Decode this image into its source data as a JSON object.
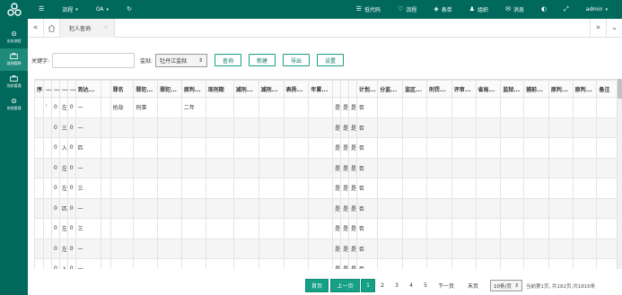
{
  "topbar": {
    "menu_icon": "hamburger-icon",
    "left_items": [
      {
        "label": "流程",
        "caret": "▾"
      },
      {
        "label": "OA",
        "caret": "▾"
      }
    ],
    "refresh_icon": "refresh-icon",
    "right_items": [
      {
        "icon": "☰",
        "label": "低代码"
      },
      {
        "icon": "♡",
        "label": "流程"
      },
      {
        "icon": "◈",
        "label": "表单"
      },
      {
        "icon": "♟",
        "label": "组织"
      },
      {
        "icon": "✉",
        "label": "消息"
      }
    ],
    "user": {
      "label": "admin",
      "caret": "▾"
    }
  },
  "sidebar": {
    "items": [
      {
        "label": "业务流程",
        "icon": "gear-icon"
      },
      {
        "label": "减刑假释",
        "icon": "briefcase-icon",
        "active": true
      },
      {
        "label": "刑务管理",
        "icon": "briefcase-icon"
      },
      {
        "label": "系统管理",
        "icon": "gear-icon"
      }
    ]
  },
  "tabs": {
    "items": [
      {
        "label": "犯人查询",
        "close": "×"
      }
    ]
  },
  "search": {
    "keyword_label": "关键字:",
    "keyword_value": "",
    "prison_label": "监狱:",
    "prison_value": "牡丹江监狱",
    "buttons": [
      "查询",
      "新建",
      "导出",
      "设置"
    ]
  },
  "table": {
    "columns": [
      "序...",
      "...",
      "...",
      "...",
      "...",
      "到达...",
      "",
      "罪名",
      "罪犯...",
      "罪犯...",
      "原判...",
      "现刑期",
      "减刑...",
      "减刑...",
      "表扬...",
      "年累...",
      "",
      "",
      "",
      "计划...",
      "分监...",
      "监区...",
      "刑罚...",
      "评审...",
      "省局...",
      "监狱...",
      "捕前...",
      "原判...",
      "原判...",
      "备注"
    ],
    "rows": [
      [
        "",
        "'",
        "0",
        "左",
        "0",
        "一",
        "",
        "抢劫",
        "刑事",
        "",
        "二年",
        "",
        "",
        "",
        "",
        "",
        "是",
        "是",
        "是",
        "否",
        "",
        "",
        "",
        "",
        "",
        "",
        "",
        "",
        "",
        ""
      ],
      [
        "",
        "",
        "0",
        "三",
        "0",
        "一",
        "",
        "",
        "",
        "",
        "",
        "",
        "",
        "",
        "",
        "",
        "是",
        "是",
        "是",
        "否",
        "",
        "",
        "",
        "",
        "",
        "",
        "",
        "",
        "",
        ""
      ],
      [
        "",
        "",
        "0",
        "入",
        "0",
        "匹",
        "",
        "",
        "",
        "",
        "",
        "",
        "",
        "",
        "",
        "",
        "是",
        "是",
        "是",
        "否",
        "",
        "",
        "",
        "",
        "",
        "",
        "",
        "",
        "",
        ""
      ],
      [
        "",
        "",
        "0",
        "左",
        "0",
        "一",
        "",
        "",
        "",
        "",
        "",
        "",
        "",
        "",
        "",
        "",
        "是",
        "是",
        "是",
        "否",
        "",
        "",
        "",
        "",
        "",
        "",
        "",
        "",
        "",
        ""
      ],
      [
        "",
        "",
        "0",
        "左",
        "0",
        "三",
        "",
        "",
        "",
        "",
        "",
        "",
        "",
        "",
        "",
        "",
        "是",
        "是",
        "是",
        "否",
        "",
        "",
        "",
        "",
        "",
        "",
        "",
        "",
        "",
        ""
      ],
      [
        "",
        "",
        "0",
        "匹",
        "0",
        "一",
        "",
        "",
        "",
        "",
        "",
        "",
        "",
        "",
        "",
        "",
        "是",
        "是",
        "是",
        "否",
        "",
        "",
        "",
        "",
        "",
        "",
        "",
        "",
        "",
        ""
      ],
      [
        "",
        "",
        "0",
        "左",
        "0",
        "三",
        "",
        "",
        "",
        "",
        "",
        "",
        "",
        "",
        "",
        "",
        "是",
        "是",
        "是",
        "否",
        "",
        "",
        "",
        "",
        "",
        "",
        "",
        "",
        "",
        ""
      ],
      [
        "",
        "",
        "0",
        "左",
        "0",
        "一",
        "",
        "",
        "",
        "",
        "",
        "",
        "",
        "",
        "",
        "",
        "是",
        "是",
        "是",
        "否",
        "",
        "",
        "",
        "",
        "",
        "",
        "",
        "",
        "",
        ""
      ],
      [
        "",
        "",
        "0",
        "入",
        "0",
        "一",
        "",
        "",
        "",
        "",
        "",
        "",
        "",
        "",
        "",
        "",
        "是",
        "是",
        "是",
        "否",
        "",
        "",
        "",
        "",
        "",
        "",
        "",
        "",
        "",
        ""
      ]
    ]
  },
  "pager": {
    "first": "首页",
    "prev": "上一页",
    "pages": [
      "1",
      "2",
      "3",
      "4",
      "5"
    ],
    "current": "1",
    "next": "下一页",
    "last": "末页",
    "page_size": "10条/页",
    "info": "当前第1页, 共182页,共1816条"
  },
  "colors": {
    "brand": "#00695c",
    "accent": "#16a085"
  }
}
